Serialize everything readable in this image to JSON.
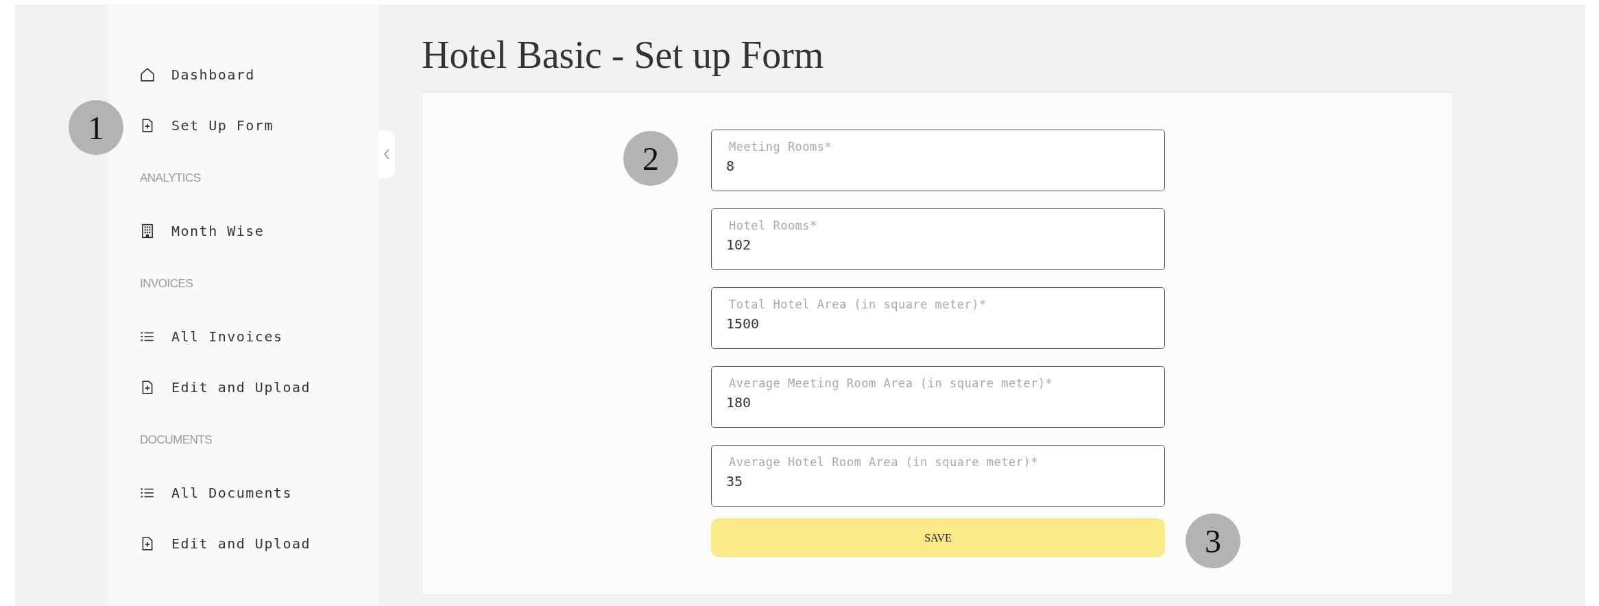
{
  "sidebar": {
    "sections": [
      {
        "items": [
          {
            "label": "Dashboard",
            "kind": "home"
          },
          {
            "label": "Set Up Form",
            "kind": "doc"
          }
        ]
      },
      {
        "heading": "ANALYTICS",
        "items": [
          {
            "label": "Month Wise",
            "kind": "building"
          }
        ]
      },
      {
        "heading": "INVOICES",
        "items": [
          {
            "label": "All Invoices",
            "kind": "list"
          },
          {
            "label": "Edit and Upload",
            "kind": "doc"
          }
        ]
      },
      {
        "heading": "DOCUMENTS",
        "items": [
          {
            "label": "All Documents",
            "kind": "list"
          },
          {
            "label": "Edit and Upload",
            "kind": "doc"
          }
        ]
      }
    ]
  },
  "page_title": "Hotel Basic - Set up Form",
  "form": {
    "fields": [
      {
        "label": "Meeting Rooms*",
        "value": "8"
      },
      {
        "label": "Hotel Rooms*",
        "value": "102"
      },
      {
        "label": "Total Hotel Area (in square meter)*",
        "value": "1500"
      },
      {
        "label": "Average Meeting Room Area (in square meter)*",
        "value": "180"
      },
      {
        "label": "Average Hotel Room Area (in square meter)*",
        "value": "35"
      }
    ],
    "submit": "SAVE"
  },
  "annotations": [
    "1",
    "2",
    "3"
  ]
}
